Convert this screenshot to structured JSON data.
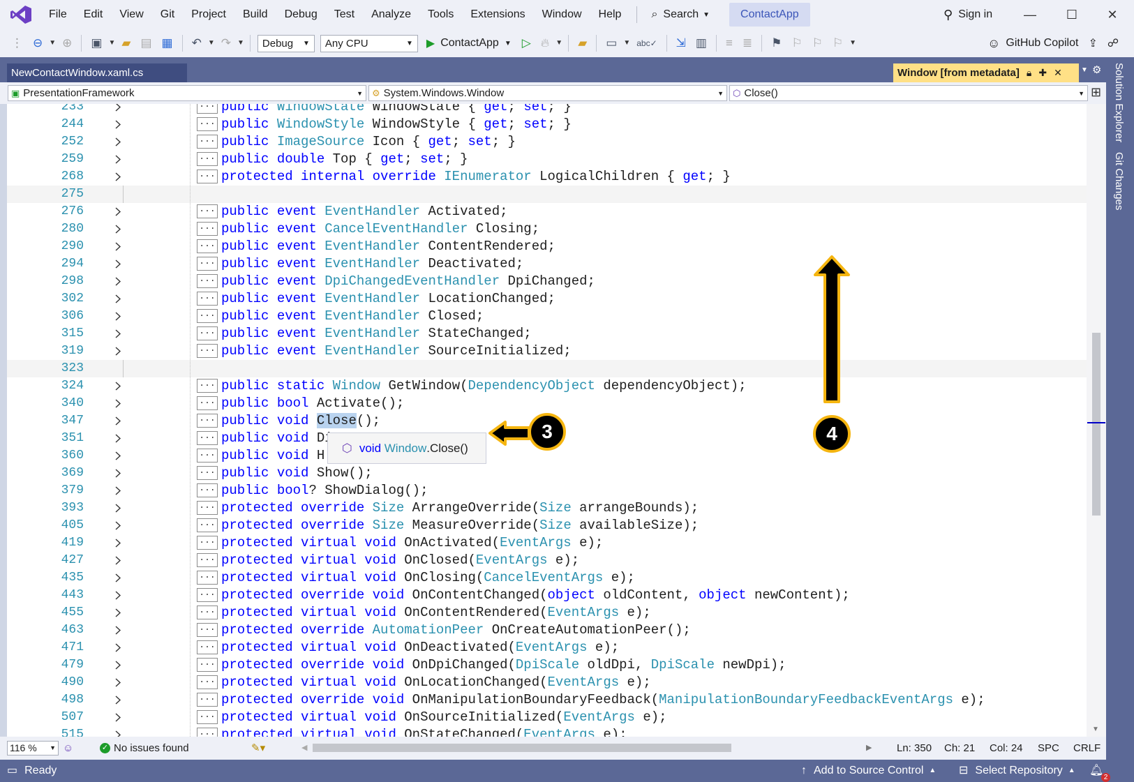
{
  "menu": [
    "File",
    "Edit",
    "View",
    "Git",
    "Project",
    "Build",
    "Debug",
    "Test",
    "Analyze",
    "Tools",
    "Extensions",
    "Window",
    "Help"
  ],
  "search_label": "Search",
  "solution_name": "ContactApp",
  "sign_in": "Sign in",
  "toolbar": {
    "config": "Debug",
    "platform": "Any CPU",
    "run_target": "ContactApp",
    "copilot": "GitHub Copilot"
  },
  "tabs": {
    "document": "NewContactWindow.xaml.cs",
    "metadata": "Window [from metadata]"
  },
  "side_tabs": [
    "Solution Explorer",
    "Git Changes"
  ],
  "navbar": {
    "project": "PresentationFramework",
    "type": "System.Windows.Window",
    "member": "Close()"
  },
  "code_lines": [
    {
      "ln": "233",
      "blank": false,
      "tokens": [
        [
          "public ",
          "kw"
        ],
        [
          "WindowState",
          "ty"
        ],
        [
          " WindowState { ",
          ""
        ],
        [
          "get",
          "kw"
        ],
        [
          "; ",
          ""
        ],
        [
          "set",
          "kw"
        ],
        [
          "; }",
          ""
        ]
      ]
    },
    {
      "ln": "244",
      "blank": false,
      "tokens": [
        [
          "public ",
          "kw"
        ],
        [
          "WindowStyle",
          "ty"
        ],
        [
          " WindowStyle { ",
          ""
        ],
        [
          "get",
          "kw"
        ],
        [
          "; ",
          ""
        ],
        [
          "set",
          "kw"
        ],
        [
          "; }",
          ""
        ]
      ]
    },
    {
      "ln": "252",
      "blank": false,
      "tokens": [
        [
          "public ",
          "kw"
        ],
        [
          "ImageSource",
          "ty"
        ],
        [
          " Icon { ",
          ""
        ],
        [
          "get",
          "kw"
        ],
        [
          "; ",
          ""
        ],
        [
          "set",
          "kw"
        ],
        [
          "; }",
          ""
        ]
      ]
    },
    {
      "ln": "259",
      "blank": false,
      "tokens": [
        [
          "public ",
          "kw"
        ],
        [
          "double",
          "kw"
        ],
        [
          " Top { ",
          ""
        ],
        [
          "get",
          "kw"
        ],
        [
          "; ",
          ""
        ],
        [
          "set",
          "kw"
        ],
        [
          "; }",
          ""
        ]
      ]
    },
    {
      "ln": "268",
      "blank": false,
      "tokens": [
        [
          "protected ",
          "kw"
        ],
        [
          "internal ",
          "kw"
        ],
        [
          "override ",
          "kw"
        ],
        [
          "IEnumerator",
          "ty"
        ],
        [
          " LogicalChildren { ",
          ""
        ],
        [
          "get",
          "kw"
        ],
        [
          "; }",
          ""
        ]
      ]
    },
    {
      "ln": "275",
      "blank": true,
      "tokens": []
    },
    {
      "ln": "276",
      "blank": false,
      "tokens": [
        [
          "public ",
          "kw"
        ],
        [
          "event ",
          "kw"
        ],
        [
          "EventHandler",
          "ty"
        ],
        [
          " Activated;",
          ""
        ]
      ]
    },
    {
      "ln": "280",
      "blank": false,
      "tokens": [
        [
          "public ",
          "kw"
        ],
        [
          "event ",
          "kw"
        ],
        [
          "CancelEventHandler",
          "ty"
        ],
        [
          " Closing;",
          ""
        ]
      ]
    },
    {
      "ln": "290",
      "blank": false,
      "tokens": [
        [
          "public ",
          "kw"
        ],
        [
          "event ",
          "kw"
        ],
        [
          "EventHandler",
          "ty"
        ],
        [
          " ContentRendered;",
          ""
        ]
      ]
    },
    {
      "ln": "294",
      "blank": false,
      "tokens": [
        [
          "public ",
          "kw"
        ],
        [
          "event ",
          "kw"
        ],
        [
          "EventHandler",
          "ty"
        ],
        [
          " Deactivated;",
          ""
        ]
      ]
    },
    {
      "ln": "298",
      "blank": false,
      "tokens": [
        [
          "public ",
          "kw"
        ],
        [
          "event ",
          "kw"
        ],
        [
          "DpiChangedEventHandler",
          "ty"
        ],
        [
          " DpiChanged;",
          ""
        ]
      ]
    },
    {
      "ln": "302",
      "blank": false,
      "tokens": [
        [
          "public ",
          "kw"
        ],
        [
          "event ",
          "kw"
        ],
        [
          "EventHandler",
          "ty"
        ],
        [
          " LocationChanged;",
          ""
        ]
      ]
    },
    {
      "ln": "306",
      "blank": false,
      "tokens": [
        [
          "public ",
          "kw"
        ],
        [
          "event ",
          "kw"
        ],
        [
          "EventHandler",
          "ty"
        ],
        [
          " Closed;",
          ""
        ]
      ]
    },
    {
      "ln": "315",
      "blank": false,
      "tokens": [
        [
          "public ",
          "kw"
        ],
        [
          "event ",
          "kw"
        ],
        [
          "EventHandler",
          "ty"
        ],
        [
          " StateChanged;",
          ""
        ]
      ]
    },
    {
      "ln": "319",
      "blank": false,
      "tokens": [
        [
          "public ",
          "kw"
        ],
        [
          "event ",
          "kw"
        ],
        [
          "EventHandler",
          "ty"
        ],
        [
          " SourceInitialized;",
          ""
        ]
      ]
    },
    {
      "ln": "323",
      "blank": true,
      "tokens": []
    },
    {
      "ln": "324",
      "blank": false,
      "tokens": [
        [
          "public ",
          "kw"
        ],
        [
          "static ",
          "kw"
        ],
        [
          "Window",
          "ty"
        ],
        [
          " GetWindow(",
          ""
        ],
        [
          "DependencyObject",
          "ty"
        ],
        [
          " dependencyObject);",
          ""
        ]
      ]
    },
    {
      "ln": "340",
      "blank": false,
      "tokens": [
        [
          "public ",
          "kw"
        ],
        [
          "bool",
          "kw"
        ],
        [
          " Activate();",
          ""
        ]
      ]
    },
    {
      "ln": "347",
      "blank": false,
      "tokens": [
        [
          "public ",
          "kw"
        ],
        [
          "void",
          "kw"
        ],
        [
          " ",
          ""
        ],
        [
          "Close",
          "hl"
        ],
        [
          "();",
          ""
        ]
      ]
    },
    {
      "ln": "351",
      "blank": false,
      "tokens": [
        [
          "public ",
          "kw"
        ],
        [
          "void",
          "kw"
        ],
        [
          " Di",
          ""
        ]
      ]
    },
    {
      "ln": "360",
      "blank": false,
      "tokens": [
        [
          "public ",
          "kw"
        ],
        [
          "void",
          "kw"
        ],
        [
          " H",
          ""
        ]
      ]
    },
    {
      "ln": "369",
      "blank": false,
      "tokens": [
        [
          "public ",
          "kw"
        ],
        [
          "void",
          "kw"
        ],
        [
          " Show();",
          ""
        ]
      ]
    },
    {
      "ln": "379",
      "blank": false,
      "tokens": [
        [
          "public ",
          "kw"
        ],
        [
          "bool",
          "kw"
        ],
        [
          "? ShowDialog();",
          ""
        ]
      ]
    },
    {
      "ln": "393",
      "blank": false,
      "tokens": [
        [
          "protected ",
          "kw"
        ],
        [
          "override ",
          "kw"
        ],
        [
          "Size",
          "ty"
        ],
        [
          " ArrangeOverride(",
          ""
        ],
        [
          "Size",
          "ty"
        ],
        [
          " arrangeBounds);",
          ""
        ]
      ]
    },
    {
      "ln": "405",
      "blank": false,
      "tokens": [
        [
          "protected ",
          "kw"
        ],
        [
          "override ",
          "kw"
        ],
        [
          "Size",
          "ty"
        ],
        [
          " MeasureOverride(",
          ""
        ],
        [
          "Size",
          "ty"
        ],
        [
          " availableSize);",
          ""
        ]
      ]
    },
    {
      "ln": "419",
      "blank": false,
      "tokens": [
        [
          "protected ",
          "kw"
        ],
        [
          "virtual ",
          "kw"
        ],
        [
          "void",
          "kw"
        ],
        [
          " OnActivated(",
          ""
        ],
        [
          "EventArgs",
          "ty"
        ],
        [
          " e);",
          ""
        ]
      ]
    },
    {
      "ln": "427",
      "blank": false,
      "tokens": [
        [
          "protected ",
          "kw"
        ],
        [
          "virtual ",
          "kw"
        ],
        [
          "void",
          "kw"
        ],
        [
          " OnClosed(",
          ""
        ],
        [
          "EventArgs",
          "ty"
        ],
        [
          " e);",
          ""
        ]
      ]
    },
    {
      "ln": "435",
      "blank": false,
      "tokens": [
        [
          "protected ",
          "kw"
        ],
        [
          "virtual ",
          "kw"
        ],
        [
          "void",
          "kw"
        ],
        [
          " OnClosing(",
          ""
        ],
        [
          "CancelEventArgs",
          "ty"
        ],
        [
          " e);",
          ""
        ]
      ]
    },
    {
      "ln": "443",
      "blank": false,
      "tokens": [
        [
          "protected ",
          "kw"
        ],
        [
          "override ",
          "kw"
        ],
        [
          "void",
          "kw"
        ],
        [
          " OnContentChanged(",
          ""
        ],
        [
          "object",
          "kw"
        ],
        [
          " oldContent, ",
          ""
        ],
        [
          "object",
          "kw"
        ],
        [
          " newContent);",
          ""
        ]
      ]
    },
    {
      "ln": "455",
      "blank": false,
      "tokens": [
        [
          "protected ",
          "kw"
        ],
        [
          "virtual ",
          "kw"
        ],
        [
          "void",
          "kw"
        ],
        [
          " OnContentRendered(",
          ""
        ],
        [
          "EventArgs",
          "ty"
        ],
        [
          " e);",
          ""
        ]
      ]
    },
    {
      "ln": "463",
      "blank": false,
      "tokens": [
        [
          "protected ",
          "kw"
        ],
        [
          "override ",
          "kw"
        ],
        [
          "AutomationPeer",
          "ty"
        ],
        [
          " OnCreateAutomationPeer();",
          ""
        ]
      ]
    },
    {
      "ln": "471",
      "blank": false,
      "tokens": [
        [
          "protected ",
          "kw"
        ],
        [
          "virtual ",
          "kw"
        ],
        [
          "void",
          "kw"
        ],
        [
          " OnDeactivated(",
          ""
        ],
        [
          "EventArgs",
          "ty"
        ],
        [
          " e);",
          ""
        ]
      ]
    },
    {
      "ln": "479",
      "blank": false,
      "tokens": [
        [
          "protected ",
          "kw"
        ],
        [
          "override ",
          "kw"
        ],
        [
          "void",
          "kw"
        ],
        [
          " OnDpiChanged(",
          ""
        ],
        [
          "DpiScale",
          "ty"
        ],
        [
          " oldDpi, ",
          ""
        ],
        [
          "DpiScale",
          "ty"
        ],
        [
          " newDpi);",
          ""
        ]
      ]
    },
    {
      "ln": "490",
      "blank": false,
      "tokens": [
        [
          "protected ",
          "kw"
        ],
        [
          "virtual ",
          "kw"
        ],
        [
          "void",
          "kw"
        ],
        [
          " OnLocationChanged(",
          ""
        ],
        [
          "EventArgs",
          "ty"
        ],
        [
          " e);",
          ""
        ]
      ]
    },
    {
      "ln": "498",
      "blank": false,
      "tokens": [
        [
          "protected ",
          "kw"
        ],
        [
          "override ",
          "kw"
        ],
        [
          "void",
          "kw"
        ],
        [
          " OnManipulationBoundaryFeedback(",
          ""
        ],
        [
          "ManipulationBoundaryFeedbackEventArgs",
          "ty"
        ],
        [
          " e);",
          ""
        ]
      ]
    },
    {
      "ln": "507",
      "blank": false,
      "tokens": [
        [
          "protected ",
          "kw"
        ],
        [
          "virtual ",
          "kw"
        ],
        [
          "void",
          "kw"
        ],
        [
          " OnSourceInitialized(",
          ""
        ],
        [
          "EventArgs",
          "ty"
        ],
        [
          " e);",
          ""
        ]
      ]
    },
    {
      "ln": "515",
      "blank": false,
      "tokens": [
        [
          "protected ",
          "kw"
        ],
        [
          "virtual ",
          "kw"
        ],
        [
          "void",
          "kw"
        ],
        [
          " OnStateChanged(",
          ""
        ],
        [
          "EventArgs",
          "ty"
        ],
        [
          " e);",
          ""
        ]
      ]
    }
  ],
  "tooltip": {
    "kw": "void",
    "type": "Window",
    "rest": ".Close()"
  },
  "callouts": [
    "3",
    "4"
  ],
  "editor_status": {
    "zoom": "116 %",
    "issues": "No issues found",
    "line": "Ln: 350",
    "char": "Ch: 21",
    "col": "Col: 24",
    "spc": "SPC",
    "eol": "CRLF"
  },
  "statusbar": {
    "ready": "Ready",
    "source_control": "Add to Source Control",
    "repo": "Select Repository",
    "notifications": "2"
  },
  "colors": {
    "keyword": "#0000ff",
    "type": "#2b91af",
    "line_number": "#2b91af",
    "accent": "#5b6896",
    "callout_ring": "#f5b510",
    "selection": "#b9d3ef"
  }
}
